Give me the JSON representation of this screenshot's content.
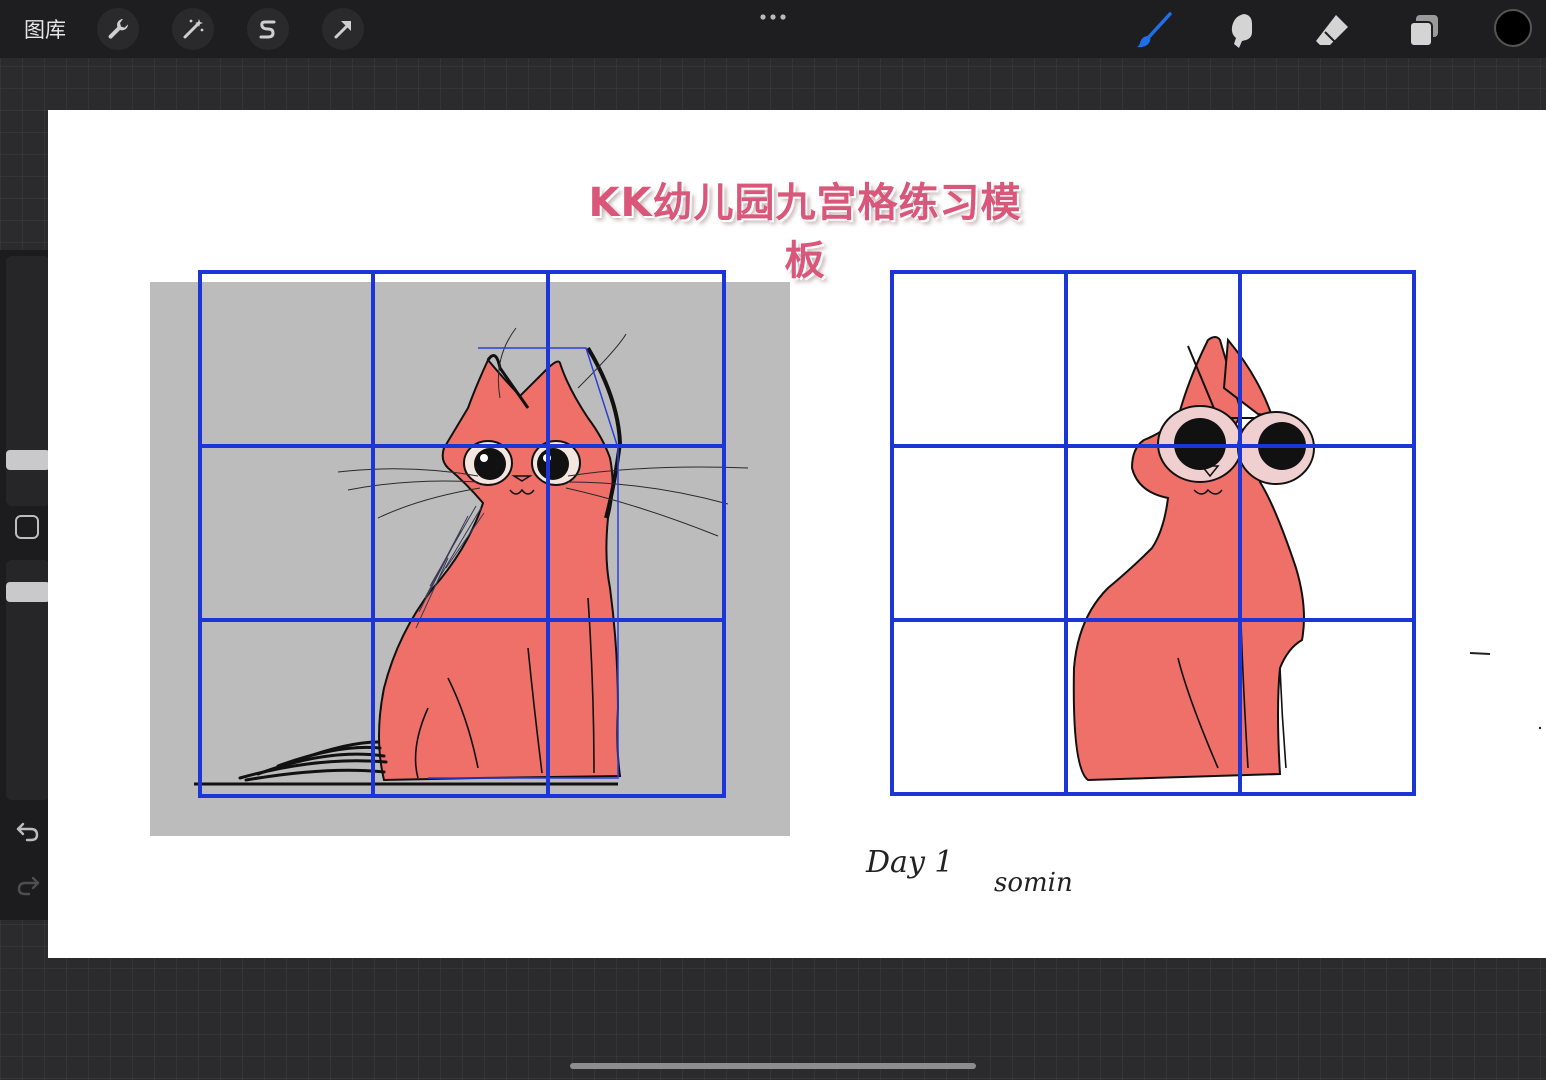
{
  "toolbar": {
    "gallery_label": "图库",
    "left_tools": [
      {
        "name": "actions",
        "icon": "wrench-icon"
      },
      {
        "name": "adjustments",
        "icon": "magic-wand-icon"
      },
      {
        "name": "selection",
        "icon": "selection-s-icon"
      },
      {
        "name": "transform",
        "icon": "arrow-cursor-icon"
      }
    ],
    "more_icon": "ellipsis-icon",
    "right_tools": [
      {
        "name": "brush",
        "icon": "brush-icon",
        "active": true
      },
      {
        "name": "smudge",
        "icon": "smudge-icon"
      },
      {
        "name": "eraser",
        "icon": "eraser-icon"
      },
      {
        "name": "layers",
        "icon": "layers-icon"
      }
    ],
    "current_color": "#000000",
    "active_color": "#1f6fe8"
  },
  "sidebar": {
    "brush_size_icon": "size-slider",
    "modify_icon": "square-modify-icon",
    "opacity_icon": "opacity-slider",
    "undo_icon": "undo-icon",
    "redo_icon": "redo-icon"
  },
  "canvas": {
    "title": "KK幼儿园九宫格练习模板",
    "title_color": "#d9577a",
    "grid_color": "#1c35d6",
    "cat_fill": "#ee7068",
    "handwriting_day": "Day 1",
    "handwriting_name": "somin"
  }
}
